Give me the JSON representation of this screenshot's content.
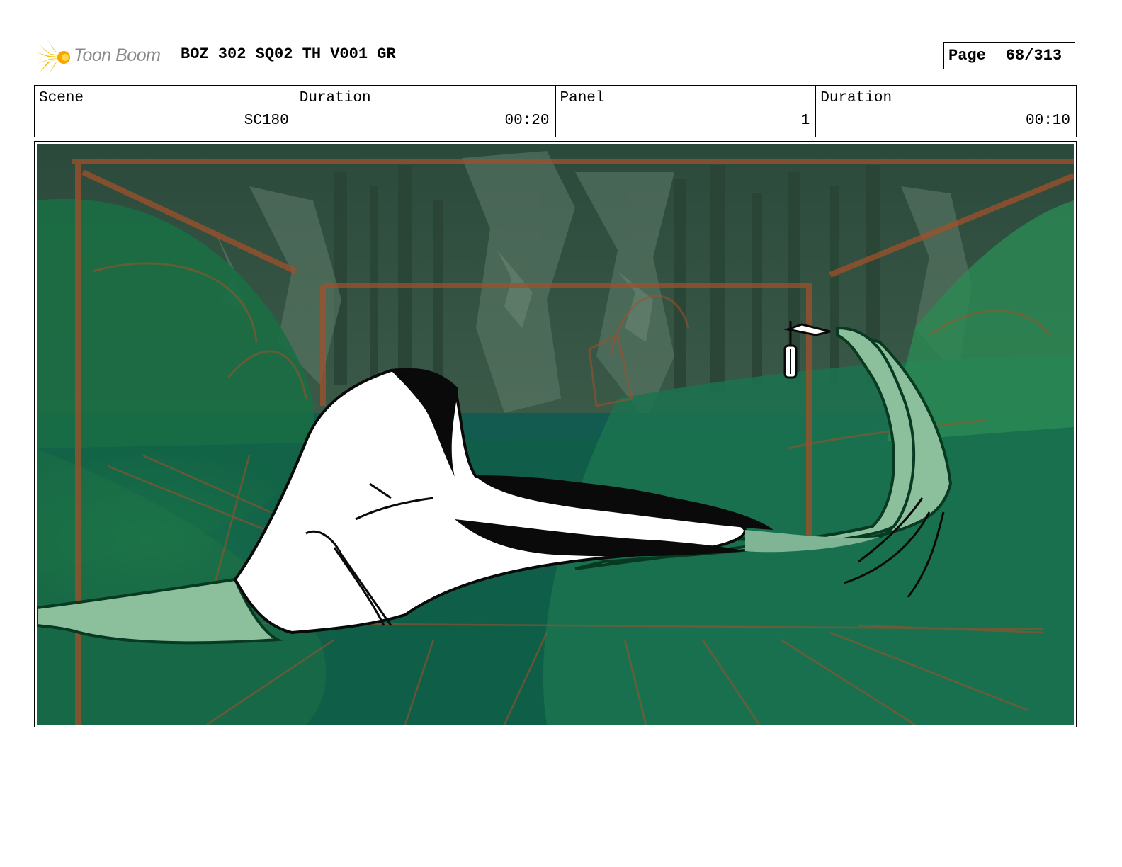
{
  "header": {
    "logo_text": "Toon Boom",
    "title": "BOZ 302 SQ02 TH V001 GR",
    "page_label": "Page",
    "page_number": "68/313"
  },
  "info": {
    "scene_label": "Scene",
    "scene_value": "SC180",
    "scene_duration_label": "Duration",
    "scene_duration_value": "00:20",
    "panel_label": "Panel",
    "panel_value": "1",
    "panel_duration_label": "Duration",
    "panel_duration_value": "00:10"
  },
  "colors": {
    "accent_logo": "#f5c400",
    "guide_lines": "#a0502a",
    "deep_green": "#0f5e48",
    "mid_green": "#1d7a4c",
    "light_green": "#8cbf9c"
  },
  "panel_image": {
    "icon": "storyboard-sketch"
  }
}
